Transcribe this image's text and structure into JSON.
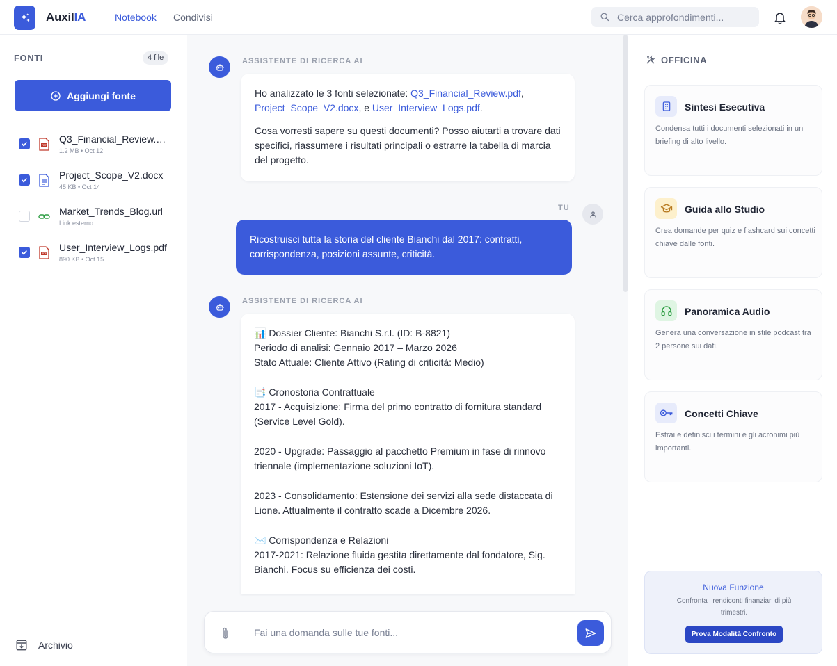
{
  "header": {
    "app_name_prefix": "Auxil",
    "app_name_accent": "IA",
    "nav": [
      {
        "label": "Notebook",
        "active": true
      },
      {
        "label": "Condivisi",
        "active": false
      }
    ],
    "search_placeholder": "Cerca approfondimenti..."
  },
  "sidebar": {
    "title": "FONTI",
    "file_count": "4 file",
    "add_button": "Aggiungi fonte",
    "files": [
      {
        "name": "Q3_Financial_Review.pdf",
        "meta": "1.2 MB • Oct 12",
        "checked": true,
        "icon": "pdf-icon"
      },
      {
        "name": "Project_Scope_V2.docx",
        "meta": "45 KB • Oct 14",
        "checked": true,
        "icon": "doc-icon"
      },
      {
        "name": "Market_Trends_Blog.url",
        "meta": "Link esterno",
        "checked": false,
        "icon": "link-icon"
      },
      {
        "name": "User_Interview_Logs.pdf",
        "meta": "890 KB • Oct 15",
        "checked": true,
        "icon": "pdf-icon"
      }
    ],
    "archive_label": "Archivio"
  },
  "chat": {
    "assistant_label": "ASSISTENTE DI RICERCA AI",
    "user_label": "TU",
    "msg1": {
      "intro": "Ho analizzato le 3 fonti selezionate: ",
      "link1": "Q3_Financial_Review.pdf",
      "sep1": ",",
      "link2": "Project_Scope_V2.docx",
      "sep2": ", e ",
      "link3": "User_Interview_Logs.pdf",
      "end": ".",
      "para2": "Cosa vorresti sapere su questi documenti? Posso aiutarti a trovare dati specifici, riassumere i risultati principali o estrarre la tabella di marcia del progetto."
    },
    "user_msg": "Ricostruisci tutta la storia del cliente Bianchi dal 2017: contratti, corrispondenza, posizioni assunte, criticità.",
    "report": {
      "l1": "📊 Dossier Cliente: Bianchi S.r.l. (ID: B-8821)",
      "l2": "Periodo di analisi: Gennaio 2017 – Marzo 2026",
      "l3": "Stato Attuale: Cliente Attivo (Rating di criticità: Medio)",
      "l4": "📑 Cronostoria Contrattuale",
      "l5": "2017 - Acquisizione: Firma del primo contratto di fornitura standard (Service Level Gold).",
      "l6": "2020 - Upgrade: Passaggio al pacchetto Premium in fase di rinnovo triennale (implementazione soluzioni IoT).",
      "l7": "2023 - Consolidamento: Estensione dei servizi alla sede distaccata di Lione. Attualmente il contratto scade a Dicembre 2026.",
      "l8": "✉️ Corrispondenza e Relazioni",
      "l9": "2017-2021: Relazione fluida gestita direttamente dal fondatore, Sig. Bianchi. Focus su efficienza dei costi."
    },
    "composer_placeholder": "Fai una domanda sulle tue fonti..."
  },
  "workshop": {
    "title": "OFFICINA",
    "cards": [
      {
        "title": "Sintesi Esecutiva",
        "desc": "Condensa tutti i documenti selezionati in un briefing di alto livello.",
        "icon": "document-summary-icon",
        "color": "#3b5bdb",
        "bg": "#e7ebfb"
      },
      {
        "title": "Guida allo Studio",
        "desc": "Crea domande per quiz e flashcard sui concetti chiave dalle fonti.",
        "icon": "graduation-cap-icon",
        "color": "#b7791f",
        "bg": "#fdf0cc"
      },
      {
        "title": "Panoramica Audio",
        "desc": "Genera una conversazione in stile podcast tra 2 persone sui dati.",
        "icon": "headphones-icon",
        "color": "#2f9e44",
        "bg": "#dff5e3"
      },
      {
        "title": "Concetti Chiave",
        "desc": "Estrai e definisci i termini e gli acronimi più importanti.",
        "icon": "key-icon",
        "color": "#3b5bdb",
        "bg": "#e7ebfb"
      }
    ],
    "promo": {
      "title": "Nuova Funzione",
      "desc": "Confronta i rendiconti finanziari di più trimestri.",
      "button": "Prova Modalità Confronto"
    }
  }
}
